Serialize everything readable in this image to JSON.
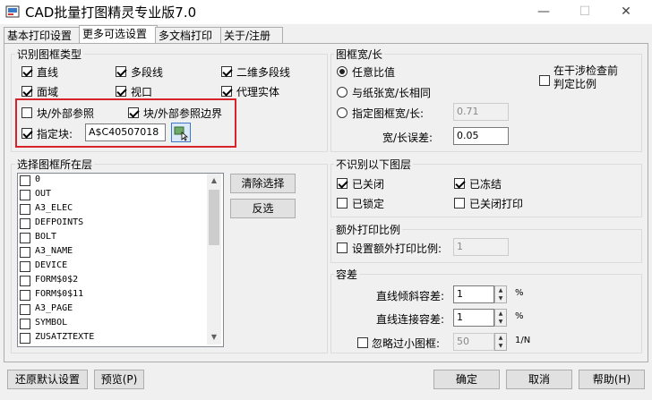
{
  "window": {
    "title": "CAD批量打图精灵专业版7.0"
  },
  "tabs": [
    "基本打印设置",
    "更多可选设置",
    "多文档打印",
    "关于/注册"
  ],
  "frame_types": {
    "label": "识别图框类型",
    "items": [
      {
        "label": "直线",
        "checked": true
      },
      {
        "label": "多段线",
        "checked": true
      },
      {
        "label": "二维多段线",
        "checked": true
      },
      {
        "label": "面域",
        "checked": true
      },
      {
        "label": "视口",
        "checked": true
      },
      {
        "label": "代理实体",
        "checked": true
      },
      {
        "label": "块/外部参照",
        "checked": false
      },
      {
        "label": "块/外部参照边界",
        "checked": true
      },
      {
        "label": "指定块:",
        "checked": true
      }
    ],
    "specified_block_value": "A$C40507018"
  },
  "ratio": {
    "label": "图框宽/长",
    "options": [
      {
        "label": "任意比值",
        "checked": true
      },
      {
        "label": "与纸张宽/长相同",
        "checked": false
      },
      {
        "label": "指定图框宽/长:",
        "checked": false
      }
    ],
    "specified_value": "0.71",
    "tolerance_label": "宽/长误差:",
    "tolerance_value": "0.05",
    "interference_check_label": "在干涉检查前判定比例"
  },
  "layers": {
    "label": "选择图框所在层",
    "items": [
      "0",
      "OUT",
      "A3_ELEC",
      "DEFPOINTS",
      "BOLT",
      "A3_NAME",
      "DEVICE",
      "FORM$0$2",
      "FORM$0$11",
      "A3_PAGE",
      "SYMBOL",
      "ZUSATZTEXTE"
    ],
    "clear_button": "清除选择",
    "invert_button": "反选"
  },
  "ignore_layers": {
    "label": "不识别以下图层",
    "items": [
      {
        "label": "已关闭",
        "checked": true
      },
      {
        "label": "已冻结",
        "checked": true
      },
      {
        "label": "已锁定",
        "checked": false
      },
      {
        "label": "已关闭打印",
        "checked": false
      }
    ]
  },
  "extra_scale": {
    "label": "额外打印比例",
    "checkbox_label": "设置额外打印比例:",
    "value": "1"
  },
  "tolerance": {
    "label": "容差",
    "tilt_label": "直线倾斜容差:",
    "tilt_value": "1",
    "tilt_unit": "%",
    "connect_label": "直线连接容差:",
    "connect_value": "1",
    "connect_unit": "%",
    "ignore_small_label": "忽略过小图框:",
    "ignore_small_value": "50",
    "ignore_small_unit": "1/N"
  },
  "buttons": {
    "restore": "还原默认设置",
    "preview": "预览(P)",
    "ok": "确定",
    "cancel": "取消",
    "help": "帮助(H)"
  },
  "titlebar_buttons": {
    "minimize": "—",
    "maximize": "☐",
    "close": "✕"
  }
}
